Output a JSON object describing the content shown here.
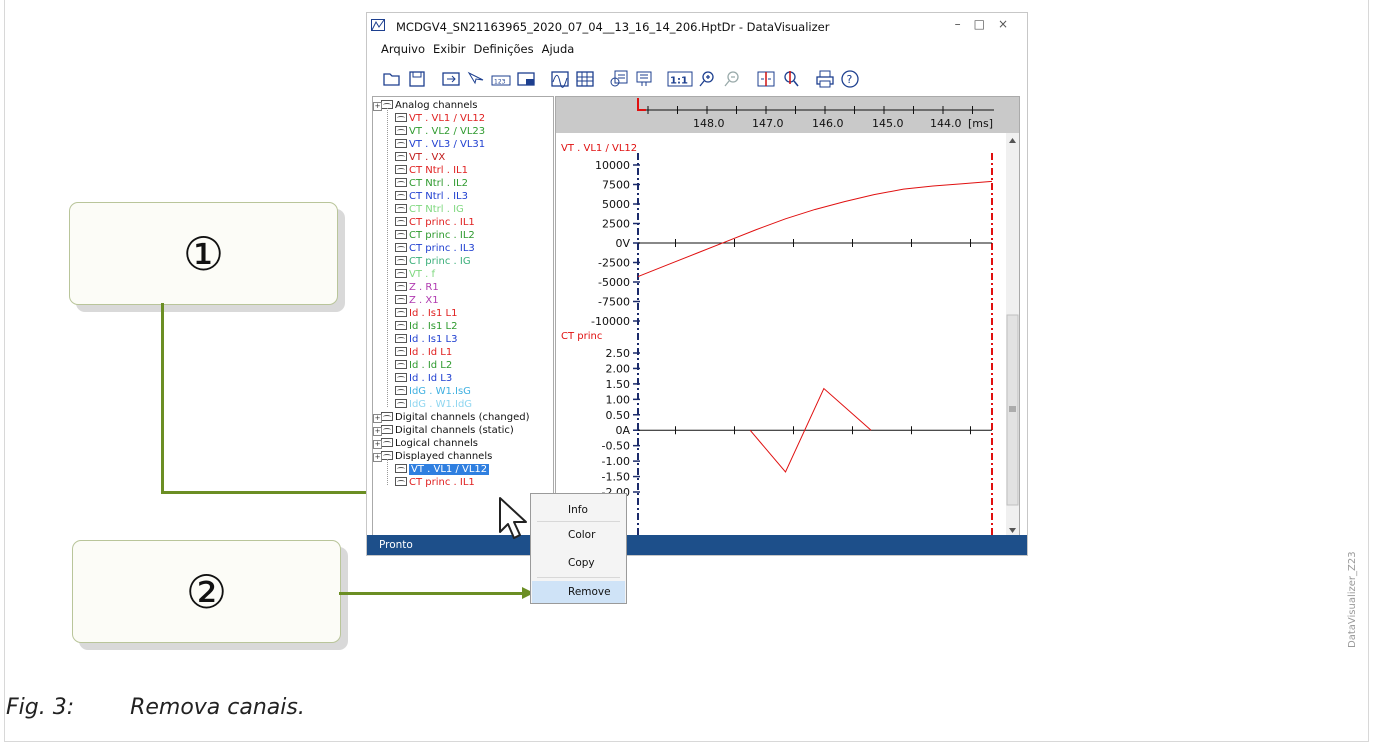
{
  "window": {
    "title": "MCDGV4_SN21163965_2020_07_04__13_16_14_206.HptDr - DataVisualizer",
    "controls": [
      "–",
      "□",
      "×"
    ],
    "menu": [
      "Arquivo",
      "Exibir",
      "Definições",
      "Ajuda"
    ],
    "toolbar_icons": [
      "open-folder-icon",
      "save-icon",
      "import-icon",
      "cursor-icon",
      "values-icon",
      "view-icon",
      "wave-icon",
      "grid-icon",
      "report-icon",
      "zoom-reset-icon",
      "zoom-in-icon",
      "zoom-out-icon",
      "marker-icon",
      "search-marker-icon",
      "print-icon",
      "help-icon"
    ],
    "zoom_label": "1:1",
    "status": "Pronto"
  },
  "tree": {
    "analog_header": "Analog channels",
    "analog": [
      {
        "label": "VT . VL1 / VL12",
        "color": "#e02020"
      },
      {
        "label": "VT . VL2 / VL23",
        "color": "#2e9a2e"
      },
      {
        "label": "VT . VL3 / VL31",
        "color": "#1f3fd0"
      },
      {
        "label": "VT . VX",
        "color": "#c01818"
      },
      {
        "label": "CT Ntrl . IL1",
        "color": "#e02020"
      },
      {
        "label": "CT Ntrl . IL2",
        "color": "#2e9a2e"
      },
      {
        "label": "CT Ntrl . IL3",
        "color": "#1f3fd0"
      },
      {
        "label": "CT Ntrl . IG",
        "color": "#7fd87f"
      },
      {
        "label": "CT princ . IL1",
        "color": "#e02020"
      },
      {
        "label": "CT princ . IL2",
        "color": "#2e9a2e"
      },
      {
        "label": "CT princ . IL3",
        "color": "#1f3fd0"
      },
      {
        "label": "CT princ . IG",
        "color": "#3aaf7a"
      },
      {
        "label": "VT . f",
        "color": "#7fd87f"
      },
      {
        "label": "Z . R1",
        "color": "#b03ab0"
      },
      {
        "label": "Z . X1",
        "color": "#b03ab0"
      },
      {
        "label": "Id . Is1 L1",
        "color": "#e02020"
      },
      {
        "label": "Id . Is1 L2",
        "color": "#2e9a2e"
      },
      {
        "label": "Id . Is1 L3",
        "color": "#1f3fd0"
      },
      {
        "label": "Id . Id L1",
        "color": "#e02020"
      },
      {
        "label": "Id . Id L2",
        "color": "#2e9a2e"
      },
      {
        "label": "Id . Id L3",
        "color": "#1f3fd0"
      },
      {
        "label": "IdG . W1.IsG",
        "color": "#3fb0e0"
      },
      {
        "label": "IdG . W1.IdG",
        "color": "#8fd6f0"
      }
    ],
    "groups": [
      "Digital channels (changed)",
      "Digital channels (static)",
      "Logical channels",
      "Displayed channels"
    ],
    "displayed": [
      {
        "label": "VT . VL1 / VL12",
        "color": "#ffffff",
        "selected": true
      },
      {
        "label": "CT princ . IL1",
        "color": "#e02020",
        "selected": false
      }
    ]
  },
  "plot": {
    "time_ticks": [
      "148.0",
      "147.0",
      "146.0",
      "145.0",
      "144.0"
    ],
    "time_unit": "[ms]",
    "accent": "#e01010",
    "grid_dark": "#1a2a6a"
  },
  "chart_data": [
    {
      "type": "line",
      "title": "VT . VL1 / VL12",
      "tick_labels": [
        "10000",
        "7500",
        "5000",
        "2500",
        "0V",
        "-2500",
        "-5000",
        "-7500",
        "-10000"
      ],
      "ylim": [
        -10000,
        10000
      ],
      "x": [
        0,
        1,
        2,
        3,
        4,
        5,
        6,
        7,
        8,
        9,
        10,
        11,
        12
      ],
      "series": [
        {
          "values": [
            -4300,
            -2800,
            -1300,
            200,
            1700,
            3100,
            4300,
            5300,
            6200,
            6900,
            7300,
            7600,
            7900
          ],
          "color": "#e01010"
        }
      ]
    },
    {
      "type": "line",
      "title": "CT princ",
      "tick_labels": [
        "2.50",
        "2.00",
        "1.50",
        "1.00",
        "0.50",
        "0A",
        "-0.50",
        "-1.00",
        "-1.50",
        "-2.00"
      ],
      "ylim": [
        -2.0,
        2.5
      ],
      "x": [
        3.8,
        5,
        6.3,
        7.9
      ],
      "series": [
        {
          "values": [
            0,
            -1.35,
            1.35,
            0
          ],
          "color": "#e01010"
        }
      ]
    }
  ],
  "context_menu": [
    "Info",
    "Color",
    "Copy",
    "Remove"
  ],
  "callouts": [
    "①",
    "②"
  ],
  "caption": "Fig. 3:        Remova canais.",
  "side_tag": "DataVisualizer_Z23"
}
